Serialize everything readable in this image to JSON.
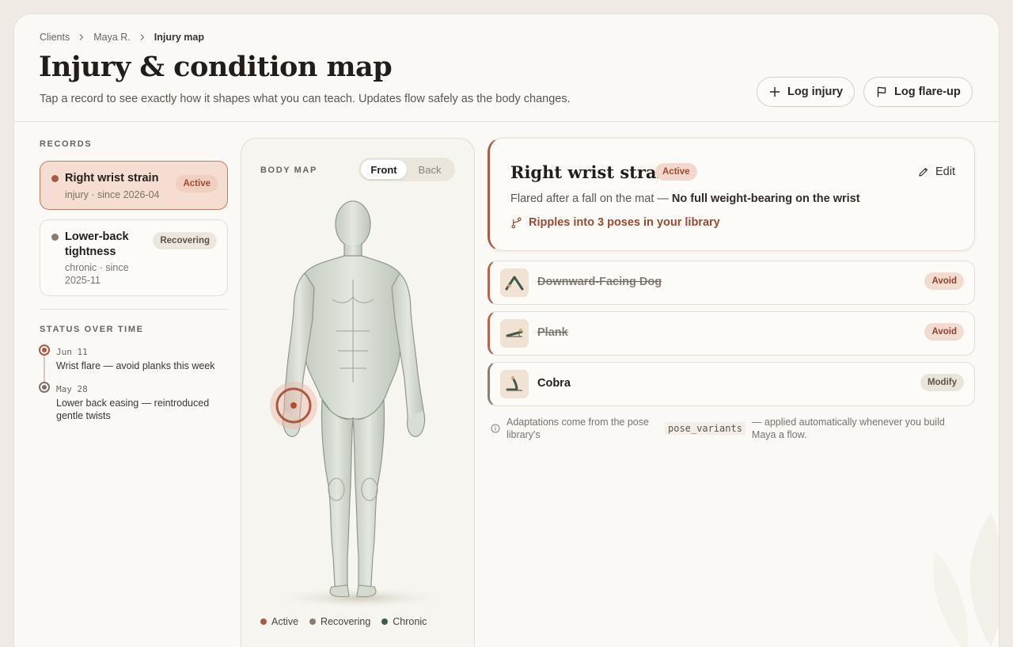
{
  "breadcrumb": {
    "item1": "Clients",
    "item2": "Maya R.",
    "current": "Injury map"
  },
  "header": {
    "title": "Injury & condition map",
    "subtitle": "Tap a record to see exactly how it shapes what you can teach. Updates flow safely as the body changes.",
    "log_injury_label": "Log injury",
    "log_flare_label": "Log flare-up"
  },
  "records": {
    "label": "RECORDS",
    "items": [
      {
        "title": "Right wrist strain",
        "meta": "injury · since 2026-04",
        "status": "Active"
      },
      {
        "title_line1": "Lower-back",
        "title_line2": "tightness",
        "meta_line1": "chronic · since",
        "meta_line2": "2025-11",
        "status": "Recovering"
      }
    ]
  },
  "status_over_time": {
    "label": "STATUS OVER TIME",
    "events": [
      {
        "date": "Jun 11",
        "text": "Wrist flare — avoid planks this week"
      },
      {
        "date": "May 28",
        "text": "Lower back easing — reintroduced gentle twists"
      }
    ]
  },
  "body_map": {
    "label": "BODY MAP",
    "view_front": "Front",
    "view_back": "Back",
    "selected_view": "Front",
    "legend": {
      "active": "Active",
      "recovering": "Recovering",
      "chronic": "Chronic"
    }
  },
  "detail": {
    "title": "Right wrist strain",
    "status": "Active",
    "edit_label": "Edit",
    "desc_plain": "Flared after a fall on the mat — ",
    "desc_bold": "No full weight-bearing on the wrist",
    "ripple_text": "Ripples into 3 poses in your library"
  },
  "poses": [
    {
      "name": "Downward-Facing Dog",
      "action": "Avoid",
      "icon": "downward-dog-icon"
    },
    {
      "name": "Plank",
      "action": "Avoid",
      "icon": "plank-icon"
    },
    {
      "name": "Cobra",
      "action": "Modify",
      "icon": "cobra-icon"
    }
  ],
  "footnote": {
    "text_before": "Adaptations come from the pose library's",
    "code": "pose_variants",
    "text_after": "— applied automatically whenever you build Maya a flow."
  },
  "colors": {
    "active": "#a95a40",
    "recovering": "#8a7a6e",
    "chronic": "#3e5a4a",
    "accent_text": "#9a4a32"
  }
}
